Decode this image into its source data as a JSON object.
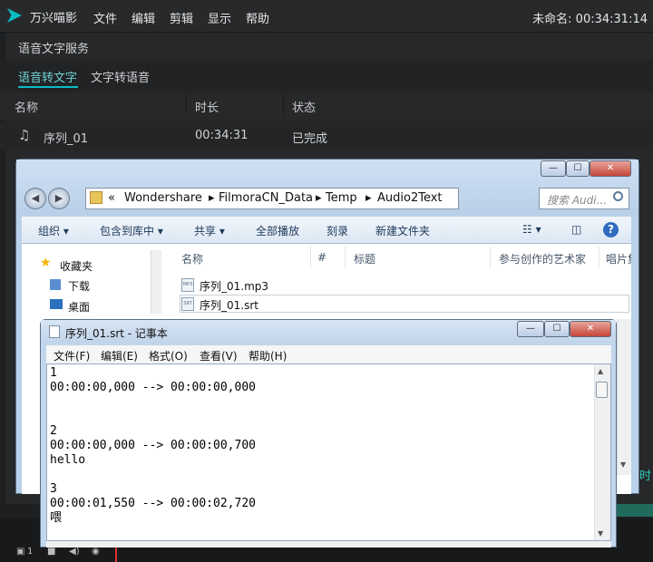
{
  "app": {
    "name": "万兴喵影",
    "menu": [
      "文件",
      "编辑",
      "剪辑",
      "显示",
      "帮助"
    ],
    "project_time": "未命名: 00:34:31:14"
  },
  "panel": {
    "title": "语音文字服务",
    "tabs": [
      "语音转文字",
      "文字转语音"
    ],
    "columns": [
      "名称",
      "时长",
      "状态"
    ],
    "row": {
      "name": "序列_01",
      "duration": "00:34:31",
      "status": "已完成"
    },
    "right_edge_text": "时"
  },
  "explorer": {
    "window_buttons": {
      "min": "—",
      "max": "☐",
      "close": "✕"
    },
    "breadcrumb": [
      "«",
      "Wondershare",
      "FilmoraCN_Data",
      "Temp",
      "Audio2Text"
    ],
    "search_placeholder": "搜索 Audi...",
    "toolbar": [
      "组织 ▾",
      "包含到库中 ▾",
      "共享 ▾",
      "全部播放",
      "刻录",
      "新建文件夹"
    ],
    "nav": {
      "favorites": "收藏夹",
      "downloads": "下载",
      "desktop": "桌面"
    },
    "columns": [
      "名称",
      "#",
      "标题",
      "参与创作的艺术家",
      "唱片集"
    ],
    "files": [
      {
        "name": "序列_01.mp3",
        "icon": "MP3"
      },
      {
        "name": "序列_01.srt",
        "icon": "SRT"
      }
    ]
  },
  "notepad": {
    "title": "序列_01.srt - 记事本",
    "menu": [
      "文件(F)",
      "编辑(E)",
      "格式(O)",
      "查看(V)",
      "帮助(H)"
    ],
    "content": "1\n00:00:00,000 --> 00:00:00,000\n\n\n2\n00:00:00,000 --> 00:00:00,700\nhello\n\n3\n00:00:01,550 --> 00:00:02,720\n喂"
  },
  "bottom": {
    "track_label": "1"
  }
}
